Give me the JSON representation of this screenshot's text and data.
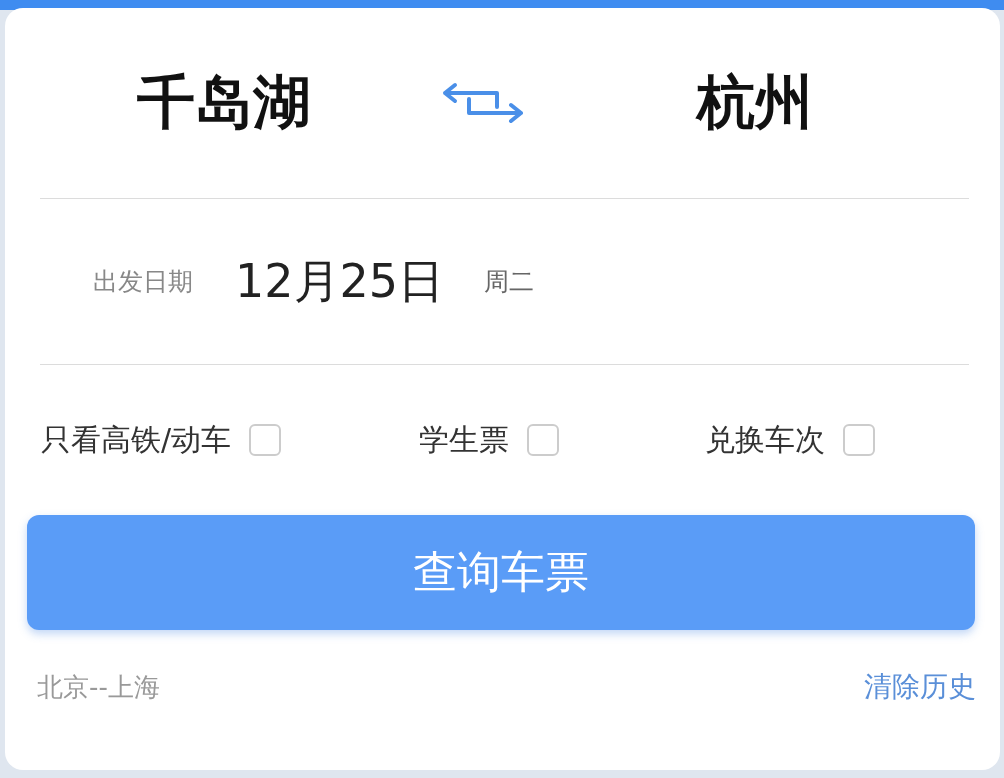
{
  "route": {
    "from": "千岛湖",
    "to": "杭州"
  },
  "date": {
    "label": "出发日期",
    "value": "12月25日",
    "weekday": "周二"
  },
  "options": [
    {
      "label": "只看高铁/动车",
      "checked": false
    },
    {
      "label": "学生票",
      "checked": false
    },
    {
      "label": "兑换车次",
      "checked": false
    }
  ],
  "search_button": "查询车票",
  "history": {
    "item": "北京--上海",
    "clear": "清除历史"
  }
}
